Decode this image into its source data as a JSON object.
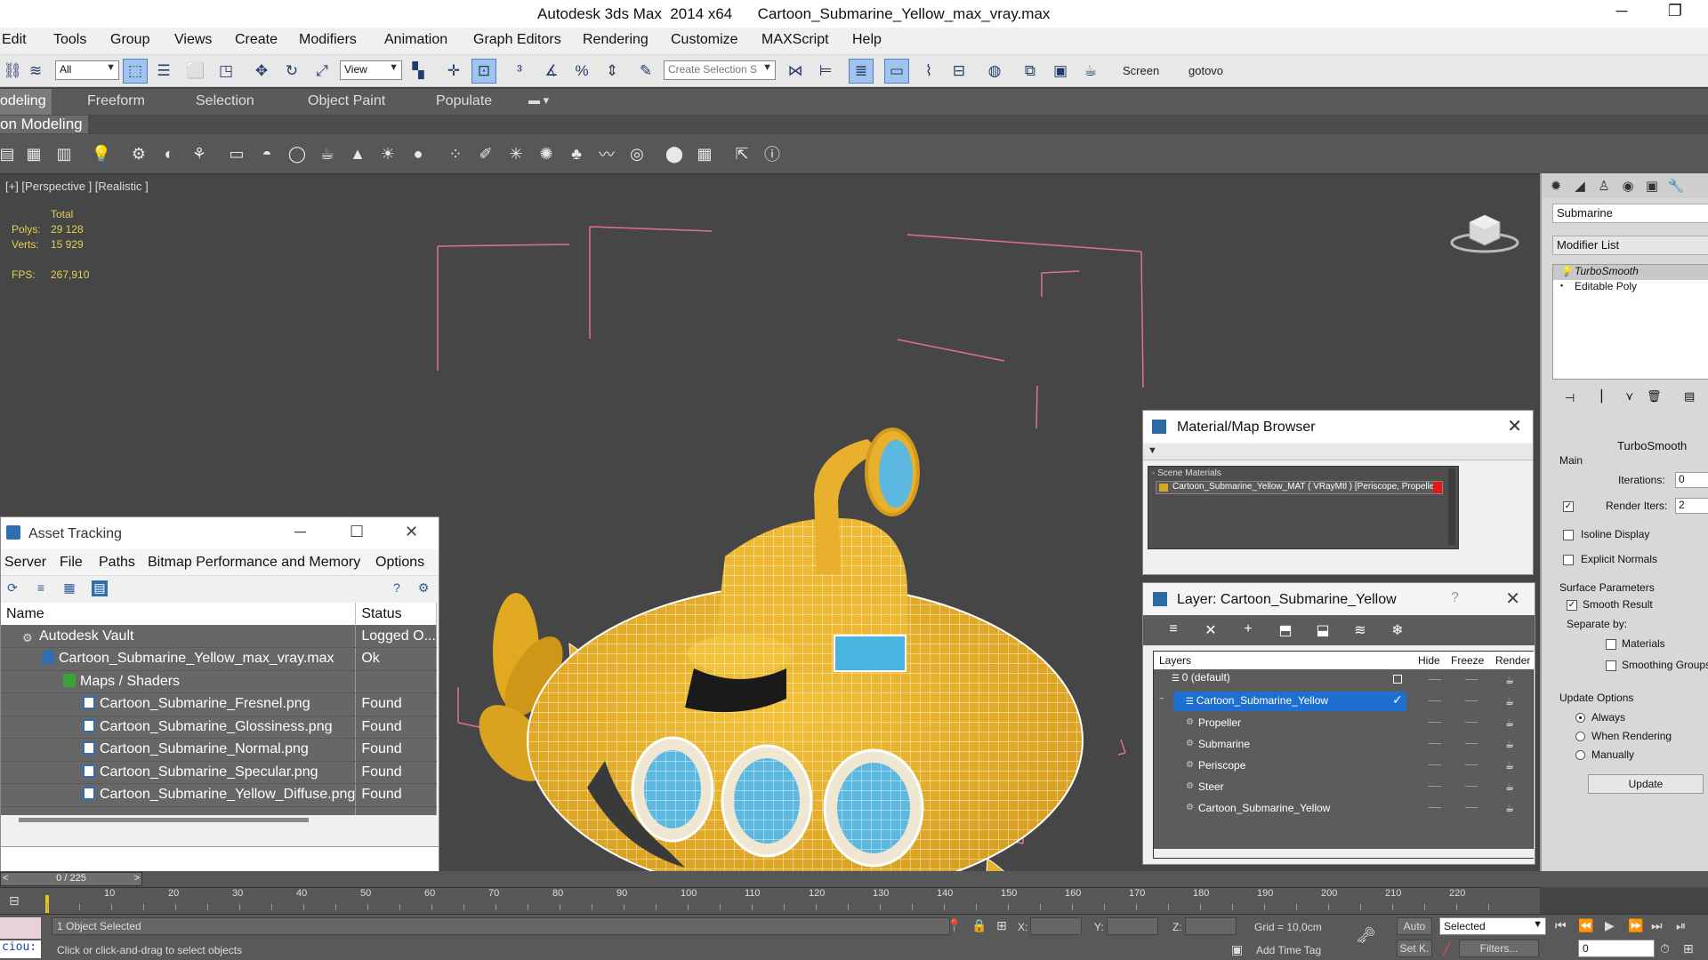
{
  "titlebar": {
    "title": "Autodesk 3ds Max  2014 x64      Cartoon_Submarine_Yellow_max_vray.max",
    "minimize": "─",
    "maximize": "❐"
  },
  "menubar": [
    "Edit",
    "Tools",
    "Group",
    "Views",
    "Create",
    "Modifiers",
    "Animation",
    "Graph Editors",
    "Rendering",
    "Customize",
    "MAXScript",
    "Help"
  ],
  "toolbar": {
    "filter_value": "All",
    "coord_value": "View",
    "named_selection_placeholder": "Create Selection S",
    "screen_label": "Screen",
    "gotovo_label": "gotovo"
  },
  "ribbon": {
    "tabs": [
      "odeling",
      "Freeform",
      "Selection",
      "Object Paint",
      "Populate"
    ],
    "subtitle": "on Modeling"
  },
  "viewport": {
    "label": "[+] [Perspective ] [Realistic ]",
    "stats": {
      "total_label": "Total",
      "polys_label": "Polys:",
      "polys_value": "29 128",
      "verts_label": "Verts:",
      "verts_value": "15 929",
      "fps_label": "FPS:",
      "fps_value": "267,910"
    }
  },
  "command_panel": {
    "object_name": "Submarine",
    "modifier_list": "Modifier List",
    "stack": [
      "TurboSmooth",
      "Editable Poly"
    ],
    "rollout_title": "TurboSmooth",
    "main_label": "Main",
    "iterations_label": "Iterations:",
    "iterations_value": "0",
    "render_iters_label": "Render Iters:",
    "render_iters_value": "2",
    "render_iters_checked": "✓",
    "isoline_label": "Isoline Display",
    "explicit_normals_label": "Explicit Normals",
    "surface_params_label": "Surface Parameters",
    "smooth_result_label": "Smooth Result",
    "smooth_result_checked": "✓",
    "separate_by_label": "Separate by:",
    "materials_label": "Materials",
    "smoothing_groups_label": "Smoothing Groups",
    "update_options_label": "Update Options",
    "always_label": "Always",
    "when_rendering_label": "When Rendering",
    "manually_label": "Manually",
    "update_button": "Update"
  },
  "asset_tracking": {
    "title": "Asset Tracking",
    "menu": [
      "Server",
      "File",
      "Paths",
      "Bitmap Performance and Memory",
      "Options"
    ],
    "columns": [
      "Name",
      "Status"
    ],
    "rows": [
      {
        "name": "Autodesk Vault",
        "status": "Logged O..."
      },
      {
        "name": "Cartoon_Submarine_Yellow_max_vray.max",
        "status": "Ok"
      },
      {
        "name": "Maps / Shaders",
        "status": ""
      },
      {
        "name": "Cartoon_Submarine_Fresnel.png",
        "status": "Found"
      },
      {
        "name": "Cartoon_Submarine_Glossiness.png",
        "status": "Found"
      },
      {
        "name": "Cartoon_Submarine_Normal.png",
        "status": "Found"
      },
      {
        "name": "Cartoon_Submarine_Specular.png",
        "status": "Found"
      },
      {
        "name": "Cartoon_Submarine_Yellow_Diffuse.png",
        "status": "Found"
      }
    ]
  },
  "material_browser": {
    "title": "Material/Map Browser",
    "group": "- Scene Materials",
    "item": "Cartoon_Submarine_Yellow_MAT ( VRayMtl ) [Periscope, Propeller,"
  },
  "layer_dialog": {
    "title": "Layer: Cartoon_Submarine_Yellow",
    "help": "?",
    "columns": {
      "layers": "Layers",
      "hide": "Hide",
      "freeze": "Freeze",
      "render": "Render"
    },
    "rows": [
      "0 (default)",
      "Cartoon_Submarine_Yellow",
      "Propeller",
      "Submarine",
      "Periscope",
      "Steer",
      "Cartoon_Submarine_Yellow"
    ]
  },
  "timeline": {
    "frame_display": "0 / 225",
    "prev": "<",
    "next": ">",
    "ticks": [
      "10",
      "20",
      "30",
      "40",
      "50",
      "60",
      "70",
      "80",
      "90",
      "100",
      "110",
      "120",
      "130",
      "140",
      "150",
      "160",
      "170",
      "180",
      "190",
      "200",
      "210",
      "220"
    ]
  },
  "statusbar": {
    "maxscript": "ciou:",
    "selection_status": "1 Object Selected",
    "prompt": "Click or click-and-drag to select objects",
    "x_label": "X:",
    "y_label": "Y:",
    "z_label": "Z:",
    "grid": "Grid = 10,0cm",
    "add_time_tag": "Add Time Tag",
    "auto": "Auto",
    "set_key": "Set K.",
    "selected_value": "Selected",
    "filters": "Filters...",
    "frame_value": "0"
  },
  "colors": {
    "submarine_yellow": "#e6b12a",
    "porthole_blue": "#5db8e0",
    "selection_blue": "#1f6fd0",
    "bounding_box": "#e07090",
    "stats_yellow": "#e4cf55"
  }
}
